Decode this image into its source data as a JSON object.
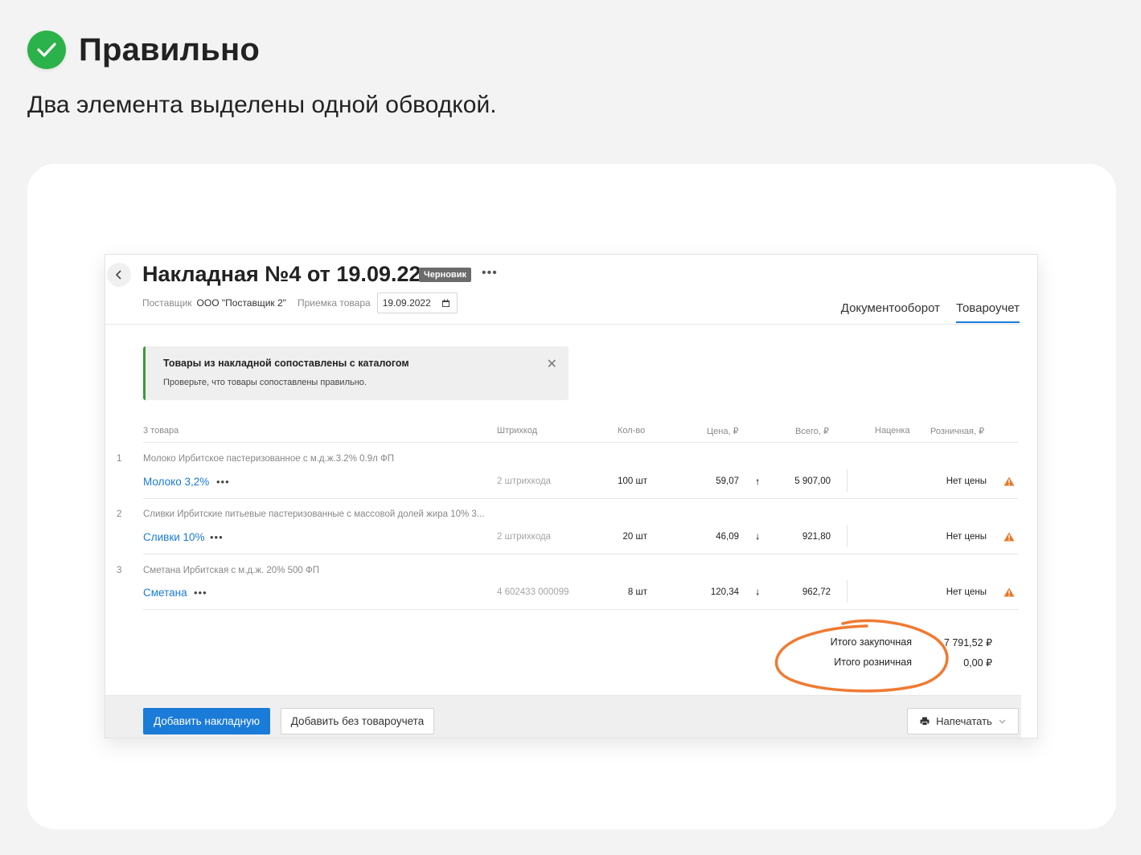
{
  "page": {
    "heading": "Правильно",
    "subtitle": "Два элемента выделены одной обводкой."
  },
  "doc": {
    "title": "Накладная №4 от 19.09.22",
    "status_badge": "Черновик",
    "supplier_label": "Поставщик",
    "supplier_value": "ООО \"Поставщик 2\"",
    "receipt_label": "Приемка товара",
    "receipt_date": "19.09.2022"
  },
  "tabs": [
    {
      "label": "Документооборот",
      "active": false
    },
    {
      "label": "Товароучет",
      "active": true
    }
  ],
  "notice": {
    "title": "Товары из накладной сопоставлены с каталогом",
    "text": "Проверьте, что товары сопоставлены правильно."
  },
  "table": {
    "headers": {
      "items": "3 товара",
      "barcode": "Штрихкод",
      "qty": "Кол-во",
      "price": "Цена, ₽",
      "total": "Всего, ₽",
      "markup": "Наценка",
      "retail": "Розничная, ₽"
    },
    "rows": [
      {
        "num": "1",
        "full_name": "Молоко Ирбитское пастеризованное с м.д.ж.3.2% 0.9л ФП",
        "short_name": "Молоко 3,2%",
        "barcode": "2 штрихкода",
        "qty": "100 шт",
        "price": "59,07",
        "trend": "up",
        "total": "5 907,00",
        "retail": "Нет цены"
      },
      {
        "num": "2",
        "full_name": "Сливки Ирбитские питьевые пастеризованные с массовой долей жира 10% 3...",
        "short_name": "Сливки 10%",
        "barcode": "2 штрихкода",
        "qty": "20 шт",
        "price": "46,09",
        "trend": "down",
        "total": "921,80",
        "retail": "Нет цены"
      },
      {
        "num": "3",
        "full_name": "Сметана Ирбитская с м.д.ж. 20% 500 ФП",
        "short_name": "Сметана",
        "barcode": "4 602433 000099",
        "qty": "8 шт",
        "price": "120,34",
        "trend": "down",
        "total": "962,72",
        "retail": "Нет цены"
      }
    ]
  },
  "summary": {
    "purchase_label": "Итого закупочная",
    "purchase_value": "7 791,52 ₽",
    "retail_label": "Итого розничная",
    "retail_value": "0,00 ₽"
  },
  "footer": {
    "add_invoice": "Добавить накладную",
    "add_without_stock": "Добавить без товароучета",
    "print": "Напечатать"
  },
  "colors": {
    "accent": "#1a7bd8",
    "success": "#2cb24a",
    "warning": "#e8782a",
    "annotation": "#f07a32"
  },
  "icons": [
    "check-icon",
    "chevron-left-icon",
    "more-dots-icon",
    "calendar-icon",
    "close-icon",
    "arrow-up-icon",
    "arrow-down-icon",
    "warning-icon",
    "printer-icon",
    "chevron-down-icon"
  ]
}
